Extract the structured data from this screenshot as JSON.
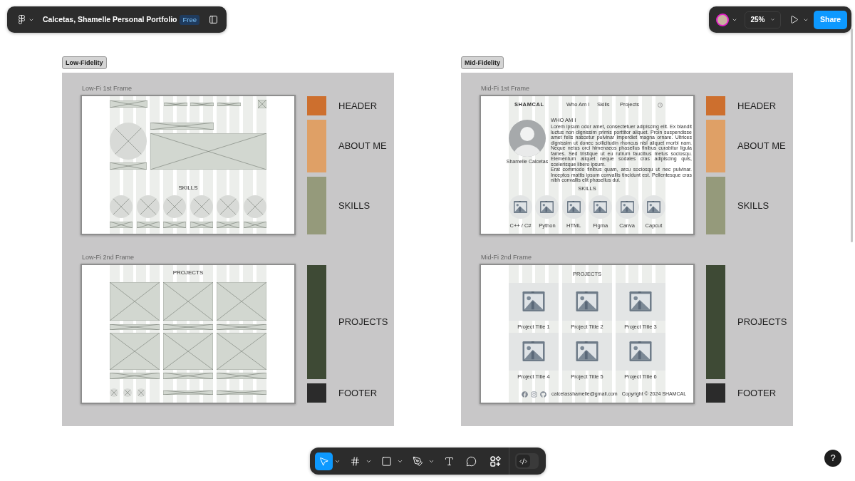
{
  "file_bar": {
    "title": "Calcetas, Shamelle Personal Portfolio",
    "plan_badge": "Free"
  },
  "view_bar": {
    "zoom": "25%",
    "share_button": "Share"
  },
  "sections": [
    {
      "label": "Low-Fidelity",
      "frames": [
        {
          "title": "Low-Fi 1st Frame",
          "kind": "lofi_home",
          "heading": "SKILLS",
          "legend": [
            {
              "label": "HEADER",
              "kind": "header",
              "color": "#cd6f2e"
            },
            {
              "label": "ABOUT ME",
              "kind": "about",
              "color": "#dfa066"
            },
            {
              "label": "SKILLS",
              "kind": "skills",
              "color": "#959a7b"
            }
          ]
        },
        {
          "title": "Low-Fi 2nd Frame",
          "kind": "lofi_projects",
          "heading": "PROJECTS",
          "legend": [
            {
              "label": "PROJECTS",
              "kind": "projects",
              "color": "#3e4a35"
            },
            {
              "label": "FOOTER",
              "kind": "footer",
              "color": "#2b2b2b"
            }
          ]
        }
      ]
    },
    {
      "label": "Mid-Fidelity",
      "frames": [
        {
          "title": "Mid-Fi 1st Frame",
          "kind": "midfi_home",
          "brand": "SHAMCAL",
          "nav": [
            "Who Am I",
            "Skills",
            "Projects"
          ],
          "profile_name": "Shamelle Calcetas",
          "about_heading": "WHO AM I",
          "about_paragraphs": [
            "Lorem ipsum odor amet, consectetuer adipiscing elit. Ex blandit luctus non dignissim primis porttitor aliquet. Proin suspendisse amet felis nascetur pulvinar imperdiet magna ornare. Ultrices dignissim ut donec sollicitudin rhoncus nisl aliquet morbi nam. Neque netus orci himenaeos phasellus finibus curabitur ligula fames. Sed tristique ut eu rutrum faucibus metus sociosqu. Elementum aliquet neque sodales cras adipiscing quis, scelerisque libero ipsum.",
            "Erat commodo finibus quam, arcu sociosqu ut nec pulvinar. Inceptos mattis ipsum convallis tincidunt est. Pellentesque cras nibh convallis elit phasellus dui."
          ],
          "skills_heading": "SKILLS",
          "skills": [
            "C++ / C#",
            "Python",
            "HTML",
            "Figma",
            "Canva",
            "Capcut"
          ],
          "legend": [
            {
              "label": "HEADER",
              "kind": "header",
              "color": "#cd6f2e"
            },
            {
              "label": "ABOUT ME",
              "kind": "about",
              "color": "#dfa066"
            },
            {
              "label": "SKILLS",
              "kind": "skills",
              "color": "#959a7b"
            }
          ]
        },
        {
          "title": "Mid-Fi 2nd Frame",
          "kind": "midfi_projects",
          "heading": "PROJECTS",
          "projects": [
            "Project Title 1",
            "Project Title 2",
            "Project Title 3",
            "Project Title 4",
            "Project Title 5",
            "Project Title 6"
          ],
          "email": "calcetasshamelle@gmail.com",
          "copyright": "Copyright © 2024 SHAMCAL",
          "legend": [
            {
              "label": "PROJECTS",
              "kind": "projects",
              "color": "#3e4a35"
            },
            {
              "label": "FOOTER",
              "kind": "footer",
              "color": "#2b2b2b"
            }
          ]
        }
      ]
    }
  ],
  "bottom_toolbar": {
    "tools": [
      {
        "selected": true
      },
      {
        "selected": false
      },
      {
        "selected": false
      },
      {
        "selected": false
      },
      {
        "selected": false
      },
      {
        "selected": false
      },
      {
        "selected": false
      }
    ],
    "dev_mode": {
      "on": false
    }
  },
  "help_button": "?"
}
